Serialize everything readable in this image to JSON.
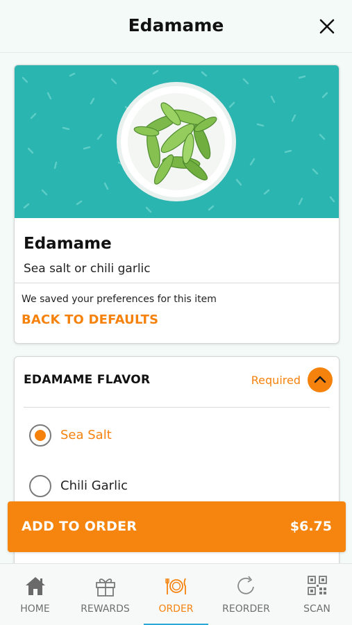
{
  "header": {
    "title": "Edamame"
  },
  "item": {
    "title": "Edamame",
    "description": "Sea salt or chili garlic",
    "pref_note": "We saved your preferences for this item",
    "defaults_link": "BACK TO DEFAULTS"
  },
  "flavor": {
    "title": "EDAMAME FLAVOR",
    "required": "Required",
    "options": [
      {
        "label": "Sea Salt",
        "selected": true
      },
      {
        "label": "Chili Garlic",
        "selected": false
      }
    ]
  },
  "add_to_order": {
    "label": "ADD TO ORDER",
    "price": "$6.75"
  },
  "tabs": [
    {
      "label": "HOME",
      "icon": "home-icon"
    },
    {
      "label": "REWARDS",
      "icon": "gift-icon"
    },
    {
      "label": "ORDER",
      "icon": "plate-cutlery-icon",
      "active": true
    },
    {
      "label": "REORDER",
      "icon": "reorder-icon"
    },
    {
      "label": "SCAN",
      "icon": "qr-code-icon"
    }
  ],
  "colors": {
    "accent": "#f5820d",
    "hero_bg": "#2bb5b0",
    "tab_underline": "#2aa9d6"
  }
}
